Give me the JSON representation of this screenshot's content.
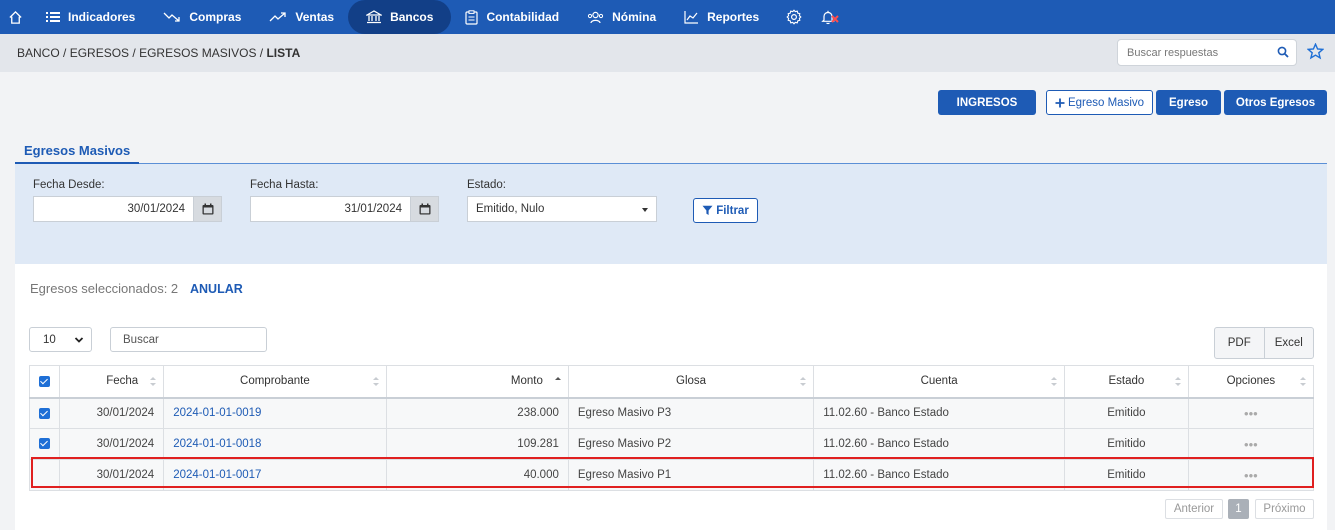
{
  "nav": {
    "home_icon": "home-icon",
    "items": [
      {
        "label": "Indicadores",
        "icon": "list-icon"
      },
      {
        "label": "Compras",
        "icon": "trend-down-icon"
      },
      {
        "label": "Ventas",
        "icon": "trend-up-icon"
      },
      {
        "label": "Bancos",
        "icon": "bank-icon",
        "active": true
      },
      {
        "label": "Contabilidad",
        "icon": "clipboard-icon"
      },
      {
        "label": "Nómina",
        "icon": "users-icon"
      },
      {
        "label": "Reportes",
        "icon": "chart-icon"
      }
    ],
    "settings_icon": "gear-icon",
    "bell_icon": "bell-icon"
  },
  "breadcrumb": {
    "parts": [
      "BANCO",
      "EGRESOS",
      "EGRESOS MASIVOS"
    ],
    "current": "LISTA"
  },
  "search": {
    "placeholder": "Buscar respuestas"
  },
  "actions": {
    "ingresos": "INGRESOS",
    "egreso_masivo": "Egreso Masivo",
    "egreso": "Egreso",
    "otros_egresos": "Otros Egresos"
  },
  "tab": {
    "label": "Egresos Masivos"
  },
  "filters": {
    "fecha_desde_label": "Fecha Desde:",
    "fecha_desde_value": "30/01/2024",
    "fecha_hasta_label": "Fecha Hasta:",
    "fecha_hasta_value": "31/01/2024",
    "estado_label": "Estado:",
    "estado_value": "Emitido, Nulo",
    "filtrar_label": "Filtrar"
  },
  "selection": {
    "text": "Egresos seleccionados: 2",
    "anular_label": "ANULAR"
  },
  "table_controls": {
    "page_size": "10",
    "search_placeholder": "Buscar",
    "pdf_label": "PDF",
    "excel_label": "Excel"
  },
  "table": {
    "headers": [
      "Fecha",
      "Comprobante",
      "Monto",
      "Glosa",
      "Cuenta",
      "Estado",
      "Opciones"
    ],
    "rows": [
      {
        "checked": true,
        "fecha": "30/01/2024",
        "comprobante": "2024-01-01-0019",
        "monto": "238.000",
        "glosa": "Egreso Masivo P3",
        "cuenta": "11.02.60 - Banco Estado",
        "estado": "Emitido",
        "opciones": "•••"
      },
      {
        "checked": true,
        "fecha": "30/01/2024",
        "comprobante": "2024-01-01-0018",
        "monto": "109.281",
        "glosa": "Egreso Masivo P2",
        "cuenta": "11.02.60 - Banco Estado",
        "estado": "Emitido",
        "opciones": "•••"
      },
      {
        "checked": false,
        "fecha": "30/01/2024",
        "comprobante": "2024-01-01-0017",
        "monto": "40.000",
        "glosa": "Egreso Masivo P1",
        "cuenta": "11.02.60 - Banco Estado",
        "estado": "Emitido",
        "opciones": "•••"
      }
    ]
  },
  "pagination": {
    "prev": "Anterior",
    "page": "1",
    "next": "Próximo"
  },
  "colors": {
    "primary": "#1e5bb5",
    "nav_active": "#123f87",
    "highlight": "#e02020"
  }
}
